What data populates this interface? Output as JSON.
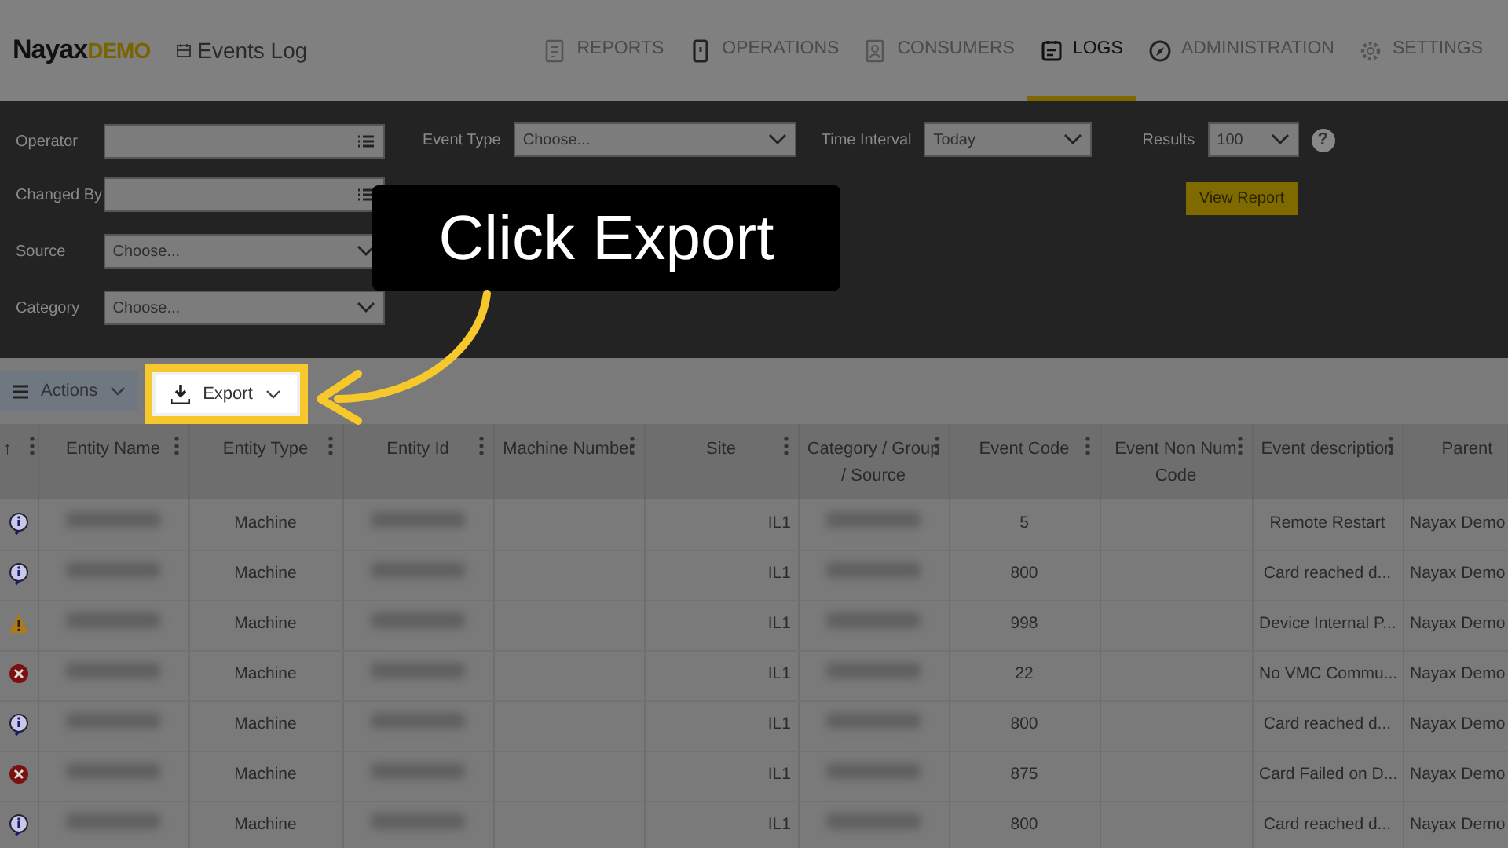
{
  "header": {
    "logo_main": "Nayax",
    "logo_accent": "DEMO",
    "page_title": "Events Log",
    "nav": [
      {
        "label": "REPORTS",
        "selected": false
      },
      {
        "label": "OPERATIONS",
        "selected": false
      },
      {
        "label": "CONSUMERS",
        "selected": false
      },
      {
        "label": "LOGS",
        "selected": true
      },
      {
        "label": "ADMINISTRATION",
        "selected": false
      },
      {
        "label": "SETTINGS",
        "selected": false
      }
    ]
  },
  "filters": {
    "left": [
      {
        "label": "Operator",
        "kind": "list"
      },
      {
        "label": "Changed By",
        "kind": "list"
      },
      {
        "label": "Source",
        "kind": "select",
        "value": "Choose..."
      },
      {
        "label": "Category",
        "kind": "select",
        "value": "Choose..."
      }
    ],
    "event_type": {
      "label": "Event Type",
      "value": "Choose..."
    },
    "time_interval": {
      "label": "Time Interval",
      "value": "Today"
    },
    "results": {
      "label": "Results",
      "value": "100"
    },
    "help": "?",
    "view_report": "View Report"
  },
  "toolbar": {
    "actions": "Actions",
    "export": "Export"
  },
  "callout": {
    "text": "Click Export"
  },
  "table": {
    "columns": [
      {
        "label": "↑"
      },
      {
        "label": "Entity Name"
      },
      {
        "label": "Entity Type"
      },
      {
        "label": "Entity Id"
      },
      {
        "label": "Machine Number"
      },
      {
        "label": "Site"
      },
      {
        "label": "Category / Group / Source"
      },
      {
        "label": "Event Code"
      },
      {
        "label": "Event Non Num Code"
      },
      {
        "label": "Event description"
      },
      {
        "label": "Parent"
      }
    ],
    "rows": [
      {
        "kind": "info",
        "entity_type": "Machine",
        "site": "IL1",
        "event_code": "5",
        "description": "Remote Restart",
        "parent": "Nayax Demo"
      },
      {
        "kind": "info",
        "entity_type": "Machine",
        "site": "IL1",
        "event_code": "800",
        "description": "Card reached d...",
        "parent": "Nayax Demo"
      },
      {
        "kind": "warning",
        "entity_type": "Machine",
        "site": "IL1",
        "event_code": "998",
        "description": "Device Internal P...",
        "parent": "Nayax Demo"
      },
      {
        "kind": "error",
        "entity_type": "Machine",
        "site": "IL1",
        "event_code": "22",
        "description": "No VMC Commu...",
        "parent": "Nayax Demo"
      },
      {
        "kind": "info",
        "entity_type": "Machine",
        "site": "IL1",
        "event_code": "800",
        "description": "Card reached d...",
        "parent": "Nayax Demo"
      },
      {
        "kind": "error",
        "entity_type": "Machine",
        "site": "IL1",
        "event_code": "875",
        "description": "Card Failed on D...",
        "parent": "Nayax Demo"
      },
      {
        "kind": "info",
        "entity_type": "Machine",
        "site": "IL1",
        "event_code": "800",
        "description": "Card reached d...",
        "parent": "Nayax Demo"
      }
    ]
  }
}
